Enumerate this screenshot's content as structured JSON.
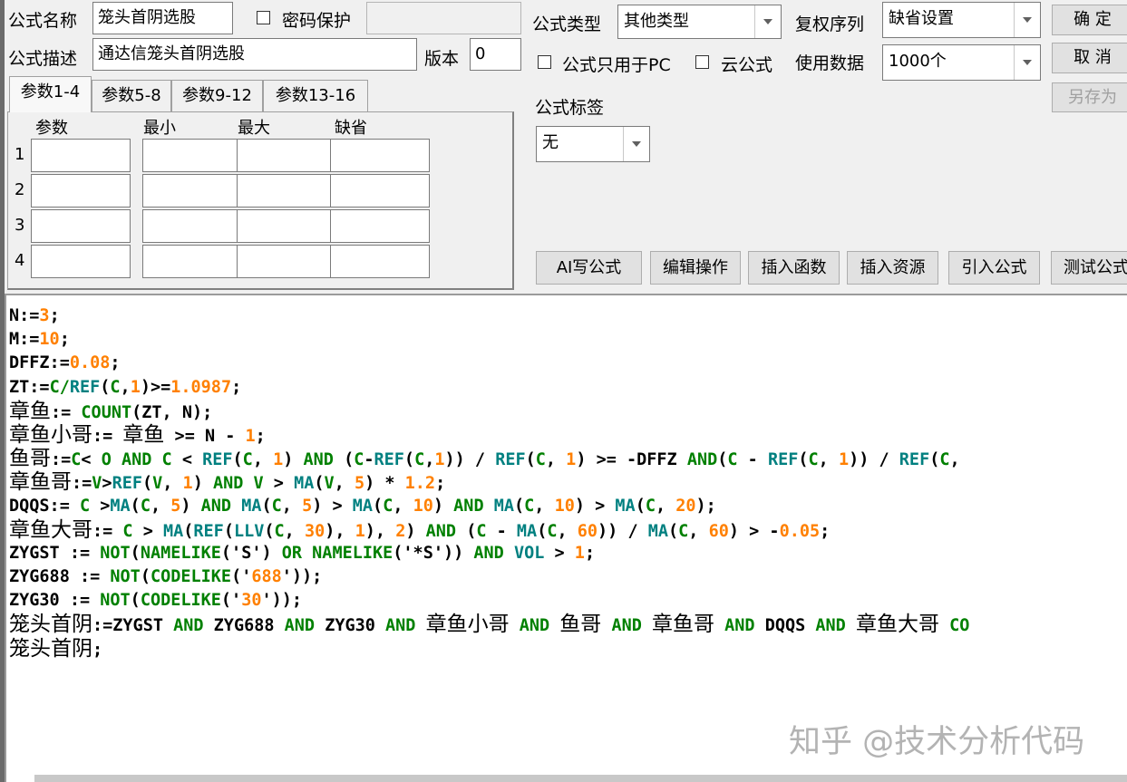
{
  "header": {
    "formula_name_label": "公式名称",
    "formula_name_value": "笼头首阴选股",
    "password_label": "密码保护",
    "password_value": "",
    "formula_desc_label": "公式描述",
    "formula_desc_value": "通达信笼头首阴选股",
    "version_label": "版本",
    "version_value": "0",
    "formula_type_label": "公式类型",
    "formula_type_value": "其他类型",
    "restore_order_label": "复权序列",
    "restore_order_value": "缺省设置",
    "pc_only_label": "公式只用于PC",
    "cloud_label": "云公式",
    "data_count_label": "使用数据",
    "data_count_value": "1000个",
    "tag_label": "公式标签",
    "tag_value": "无"
  },
  "buttons": {
    "ok": "确 定",
    "cancel": "取 消",
    "save_as": "另存为",
    "ai_write": "AI写公式",
    "edit_ops": "编辑操作",
    "insert_func": "插入函数",
    "insert_res": "插入资源",
    "import_formula": "引入公式",
    "test_formula": "测试公式"
  },
  "tabs": [
    "参数1-4",
    "参数5-8",
    "参数9-12",
    "参数13-16"
  ],
  "param_table": {
    "headers": [
      "参数",
      "最小",
      "最大",
      "缺省"
    ],
    "row_numbers": [
      "1",
      "2",
      "3",
      "4"
    ]
  },
  "editor": {
    "lines": [
      [
        [
          "N:=",
          "default"
        ],
        [
          "3",
          "num"
        ],
        [
          ";",
          "default"
        ]
      ],
      [
        [
          "M:=",
          "default"
        ],
        [
          "10",
          "num"
        ],
        [
          ";",
          "default"
        ]
      ],
      [
        [
          "DFFZ:=",
          "default"
        ],
        [
          "0.08",
          "num"
        ],
        [
          ";",
          "default"
        ]
      ],
      [
        [
          "ZT:=",
          "default"
        ],
        [
          "C/",
          "kw"
        ],
        [
          "REF",
          "func"
        ],
        [
          "(",
          "default"
        ],
        [
          "C",
          "kw"
        ],
        [
          ",",
          "default"
        ],
        [
          "1",
          "num"
        ],
        [
          ")>=",
          "default"
        ],
        [
          "1.0987",
          "num"
        ],
        [
          ";",
          "default"
        ]
      ],
      [
        [
          "章鱼",
          "cjk"
        ],
        [
          ":= ",
          "default"
        ],
        [
          "COUNT",
          "kw"
        ],
        [
          "(ZT, N);",
          "default"
        ]
      ],
      [
        [
          "章鱼小哥",
          "cjk"
        ],
        [
          ":= ",
          "default"
        ],
        [
          "章鱼",
          "cjk"
        ],
        [
          " >= N - ",
          "default"
        ],
        [
          "1",
          "num"
        ],
        [
          ";",
          "default"
        ]
      ],
      [
        [
          "鱼哥",
          "cjk"
        ],
        [
          ":=",
          "default"
        ],
        [
          "C",
          "kw"
        ],
        [
          "< ",
          "default"
        ],
        [
          "O",
          "kw"
        ],
        [
          " ",
          "default"
        ],
        [
          "AND",
          "kw"
        ],
        [
          " ",
          "default"
        ],
        [
          "C",
          "kw"
        ],
        [
          " < ",
          "default"
        ],
        [
          "REF",
          "func"
        ],
        [
          "(",
          "default"
        ],
        [
          "C",
          "kw"
        ],
        [
          ", ",
          "default"
        ],
        [
          "1",
          "num"
        ],
        [
          ") ",
          "default"
        ],
        [
          "AND",
          "kw"
        ],
        [
          " (",
          "default"
        ],
        [
          "C",
          "kw"
        ],
        [
          "-",
          "default"
        ],
        [
          "REF",
          "func"
        ],
        [
          "(",
          "default"
        ],
        [
          "C",
          "kw"
        ],
        [
          ",",
          "default"
        ],
        [
          "1",
          "num"
        ],
        [
          ")) / ",
          "default"
        ],
        [
          "REF",
          "func"
        ],
        [
          "(",
          "default"
        ],
        [
          "C",
          "kw"
        ],
        [
          ", ",
          "default"
        ],
        [
          "1",
          "num"
        ],
        [
          ") >= -DFFZ ",
          "default"
        ],
        [
          "AND",
          "kw"
        ],
        [
          "(",
          "default"
        ],
        [
          "C",
          "kw"
        ],
        [
          " - ",
          "default"
        ],
        [
          "REF",
          "func"
        ],
        [
          "(",
          "default"
        ],
        [
          "C",
          "kw"
        ],
        [
          ", ",
          "default"
        ],
        [
          "1",
          "num"
        ],
        [
          ")) / ",
          "default"
        ],
        [
          "REF",
          "func"
        ],
        [
          "(",
          "default"
        ],
        [
          "C",
          "kw"
        ],
        [
          ",",
          "default"
        ]
      ],
      [
        [
          "章鱼哥",
          "cjk"
        ],
        [
          ":=",
          "default"
        ],
        [
          "V",
          "kw"
        ],
        [
          ">",
          "default"
        ],
        [
          "REF",
          "func"
        ],
        [
          "(",
          "default"
        ],
        [
          "V",
          "kw"
        ],
        [
          ", ",
          "default"
        ],
        [
          "1",
          "num"
        ],
        [
          ") ",
          "default"
        ],
        [
          "AND",
          "kw"
        ],
        [
          " ",
          "default"
        ],
        [
          "V",
          "kw"
        ],
        [
          " > ",
          "default"
        ],
        [
          "MA",
          "func"
        ],
        [
          "(",
          "default"
        ],
        [
          "V",
          "kw"
        ],
        [
          ", ",
          "default"
        ],
        [
          "5",
          "num"
        ],
        [
          ") * ",
          "default"
        ],
        [
          "1.2",
          "num"
        ],
        [
          ";",
          "default"
        ]
      ],
      [
        [
          "DQQS:= ",
          "default"
        ],
        [
          "C",
          "kw"
        ],
        [
          " >",
          "default"
        ],
        [
          "MA",
          "func"
        ],
        [
          "(",
          "default"
        ],
        [
          "C",
          "kw"
        ],
        [
          ", ",
          "default"
        ],
        [
          "5",
          "num"
        ],
        [
          ") ",
          "default"
        ],
        [
          "AND",
          "kw"
        ],
        [
          " ",
          "default"
        ],
        [
          "MA",
          "func"
        ],
        [
          "(",
          "default"
        ],
        [
          "C",
          "kw"
        ],
        [
          ", ",
          "default"
        ],
        [
          "5",
          "num"
        ],
        [
          ") > ",
          "default"
        ],
        [
          "MA",
          "func"
        ],
        [
          "(",
          "default"
        ],
        [
          "C",
          "kw"
        ],
        [
          ", ",
          "default"
        ],
        [
          "10",
          "num"
        ],
        [
          ") ",
          "default"
        ],
        [
          "AND",
          "kw"
        ],
        [
          " ",
          "default"
        ],
        [
          "MA",
          "func"
        ],
        [
          "(",
          "default"
        ],
        [
          "C",
          "kw"
        ],
        [
          ", ",
          "default"
        ],
        [
          "10",
          "num"
        ],
        [
          ") > ",
          "default"
        ],
        [
          "MA",
          "func"
        ],
        [
          "(",
          "default"
        ],
        [
          "C",
          "kw"
        ],
        [
          ", ",
          "default"
        ],
        [
          "20",
          "num"
        ],
        [
          ");",
          "default"
        ]
      ],
      [
        [
          "章鱼大哥",
          "cjk"
        ],
        [
          ":= ",
          "default"
        ],
        [
          "C",
          "kw"
        ],
        [
          " > ",
          "default"
        ],
        [
          "MA",
          "func"
        ],
        [
          "(",
          "default"
        ],
        [
          "REF",
          "func"
        ],
        [
          "(",
          "default"
        ],
        [
          "LLV",
          "func"
        ],
        [
          "(",
          "default"
        ],
        [
          "C",
          "kw"
        ],
        [
          ", ",
          "default"
        ],
        [
          "30",
          "num"
        ],
        [
          "), ",
          "default"
        ],
        [
          "1",
          "num"
        ],
        [
          "), ",
          "default"
        ],
        [
          "2",
          "num"
        ],
        [
          ") ",
          "default"
        ],
        [
          "AND",
          "kw"
        ],
        [
          " (",
          "default"
        ],
        [
          "C",
          "kw"
        ],
        [
          " - ",
          "default"
        ],
        [
          "MA",
          "func"
        ],
        [
          "(",
          "default"
        ],
        [
          "C",
          "kw"
        ],
        [
          ", ",
          "default"
        ],
        [
          "60",
          "num"
        ],
        [
          ")) / ",
          "default"
        ],
        [
          "MA",
          "func"
        ],
        [
          "(",
          "default"
        ],
        [
          "C",
          "kw"
        ],
        [
          ", ",
          "default"
        ],
        [
          "60",
          "num"
        ],
        [
          ") > -",
          "default"
        ],
        [
          "0.05",
          "num"
        ],
        [
          ";",
          "default"
        ]
      ],
      [
        [
          "ZYGST := ",
          "default"
        ],
        [
          "NOT",
          "kw"
        ],
        [
          "(",
          "default"
        ],
        [
          "NAMELIKE",
          "kw"
        ],
        [
          "('S') ",
          "default"
        ],
        [
          "OR",
          "kw"
        ],
        [
          " ",
          "default"
        ],
        [
          "NAMELIKE",
          "kw"
        ],
        [
          "('*S')) ",
          "default"
        ],
        [
          "AND",
          "kw"
        ],
        [
          " ",
          "default"
        ],
        [
          "VOL",
          "func"
        ],
        [
          " > ",
          "default"
        ],
        [
          "1",
          "num"
        ],
        [
          ";",
          "default"
        ]
      ],
      [
        [
          "ZYG688 := ",
          "default"
        ],
        [
          "NOT",
          "kw"
        ],
        [
          "(",
          "default"
        ],
        [
          "CODELIKE",
          "kw"
        ],
        [
          "('",
          "default"
        ],
        [
          "688",
          "num"
        ],
        [
          "'));",
          "default"
        ]
      ],
      [
        [
          "ZYG30 := ",
          "default"
        ],
        [
          "NOT",
          "kw"
        ],
        [
          "(",
          "default"
        ],
        [
          "CODELIKE",
          "kw"
        ],
        [
          "('",
          "default"
        ],
        [
          "30",
          "num"
        ],
        [
          "'));",
          "default"
        ]
      ],
      [
        [
          "笼头首阴",
          "cjk"
        ],
        [
          ":=ZYGST ",
          "default"
        ],
        [
          "AND",
          "kw"
        ],
        [
          " ZYG688 ",
          "default"
        ],
        [
          "AND",
          "kw"
        ],
        [
          " ZYG30 ",
          "default"
        ],
        [
          "AND",
          "kw"
        ],
        [
          " ",
          "default"
        ],
        [
          "章鱼小哥",
          "cjk"
        ],
        [
          " ",
          "default"
        ],
        [
          "AND",
          "kw"
        ],
        [
          " ",
          "default"
        ],
        [
          "鱼哥",
          "cjk"
        ],
        [
          " ",
          "default"
        ],
        [
          "AND",
          "kw"
        ],
        [
          " ",
          "default"
        ],
        [
          "章鱼哥",
          "cjk"
        ],
        [
          " ",
          "default"
        ],
        [
          "AND",
          "kw"
        ],
        [
          " DQQS ",
          "default"
        ],
        [
          "AND",
          "kw"
        ],
        [
          " ",
          "default"
        ],
        [
          "章鱼大哥",
          "cjk"
        ],
        [
          " ",
          "default"
        ],
        [
          "CO",
          "kw"
        ]
      ],
      [
        [
          "笼头首阴",
          "cjk"
        ],
        [
          ";",
          "default"
        ]
      ]
    ]
  },
  "watermark": "知乎 @技术分析代码",
  "colors": {
    "number": "#ff8000",
    "function": "#008080",
    "keyword": "#008000",
    "text": "#000000"
  }
}
